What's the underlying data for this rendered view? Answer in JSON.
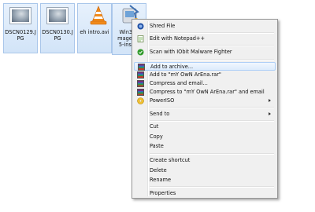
{
  "desktop": {
    "files": [
      {
        "name": "DSCN0129.J\nPG"
      },
      {
        "name": "DSCN0130.J\nPG"
      },
      {
        "name": "eh intro.avi"
      },
      {
        "name": "Win320\nmager-0.\n5-install"
      }
    ]
  },
  "context_menu": {
    "items": [
      {
        "label": "Shred File",
        "icon": "shred-icon"
      },
      {
        "label": "Edit with Notepad++",
        "icon": "notepad-plus-plus-icon"
      },
      {
        "label": "Scan with IObit Malware Fighter",
        "icon": "iobit-shield-icon"
      },
      {
        "label": "Add to archive...",
        "icon": "winrar-icon",
        "highlighted": true
      },
      {
        "label": "Add to \"mY OwN ArEna.rar\"",
        "icon": "winrar-icon"
      },
      {
        "label": "Compress and email...",
        "icon": "winrar-icon"
      },
      {
        "label": "Compress to \"mY OwN ArEna.rar\" and email",
        "icon": "winrar-icon"
      },
      {
        "label": "PowerISO",
        "icon": "poweriso-icon",
        "submenu": true
      },
      {
        "label": "Send to",
        "submenu": true
      },
      {
        "label": "Cut"
      },
      {
        "label": "Copy"
      },
      {
        "label": "Paste"
      },
      {
        "label": "Create shortcut"
      },
      {
        "label": "Delete"
      },
      {
        "label": "Rename"
      },
      {
        "label": "Properties"
      }
    ]
  },
  "colors": {
    "menu_background": "#f0f0f0",
    "highlight": "#dcebfc",
    "selection_border": "#a9c6ea"
  }
}
